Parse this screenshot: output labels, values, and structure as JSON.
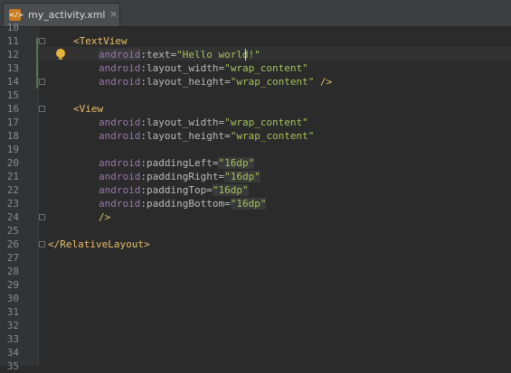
{
  "tab": {
    "label": "my_activity.xml",
    "icon": "xml-file-icon",
    "close": "×"
  },
  "editor": {
    "line_numbers": [
      "10",
      "11",
      "12",
      "13",
      "14",
      "15",
      "16",
      "17",
      "18",
      "19",
      "20",
      "21",
      "22",
      "23",
      "24",
      "25",
      "26",
      "27",
      "28",
      "29",
      "30",
      "31",
      "32",
      "33",
      "34",
      "35"
    ],
    "code": {
      "l11": {
        "tag": "<TextView"
      },
      "l12": {
        "ns": "android",
        "attr": ":text=",
        "val": "\"Hello world!\""
      },
      "l13": {
        "ns": "android",
        "attr": ":layout_width=",
        "val": "\"wrap_content\""
      },
      "l14": {
        "ns": "android",
        "attr": ":layout_height=",
        "val": "\"wrap_content\"",
        "end": " />"
      },
      "l16": {
        "tag": "<View"
      },
      "l17": {
        "ns": "android",
        "attr": ":layout_width=",
        "val": "\"wrap_content\""
      },
      "l18": {
        "ns": "android",
        "attr": ":layout_height=",
        "val": "\"wrap_content\""
      },
      "l20": {
        "ns": "android",
        "attr": ":paddingLeft=",
        "val": "\"16dp\""
      },
      "l21": {
        "ns": "android",
        "attr": ":paddingRight=",
        "val": "\"16dp\""
      },
      "l22": {
        "ns": "android",
        "attr": ":paddingTop=",
        "val": "\"16dp\""
      },
      "l23": {
        "ns": "android",
        "attr": ":paddingBottom=",
        "val": "\"16dp\""
      },
      "l24": {
        "tag": "/>"
      },
      "l26": {
        "tag": "</RelativeLayout>"
      }
    }
  },
  "colors": {
    "background": "#2b2b2b",
    "tag": "#e8bf6a",
    "namespace": "#9876aa",
    "value": "#a5c25c"
  }
}
